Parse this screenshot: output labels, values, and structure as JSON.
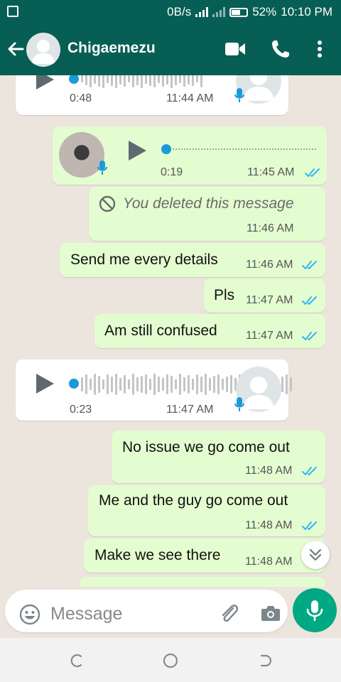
{
  "status_bar": {
    "net_speed": "0B/s",
    "battery": "52%",
    "time": "10:10 PM"
  },
  "header": {
    "contact_name": "Chigaemezu",
    "icons": [
      "back-arrow-icon",
      "avatar-icon",
      "video-call-icon",
      "phone-icon",
      "more-vert-icon"
    ]
  },
  "messages": [
    {
      "type": "voice",
      "direction": "in",
      "duration": "0:48",
      "time": "11:44 AM"
    },
    {
      "type": "voice",
      "direction": "out",
      "duration": "0:19",
      "time": "11:45 AM",
      "read": true
    },
    {
      "type": "deleted",
      "direction": "out",
      "text": "You deleted this message",
      "time": "11:46 AM"
    },
    {
      "type": "text",
      "direction": "out",
      "text": "Send me every details",
      "time": "11:46 AM",
      "read": true
    },
    {
      "type": "text",
      "direction": "out",
      "text": "Pls",
      "time": "11:47 AM",
      "read": true
    },
    {
      "type": "text",
      "direction": "out",
      "text": "Am still confused",
      "time": "11:47 AM",
      "read": true
    },
    {
      "type": "voice",
      "direction": "in",
      "duration": "0:23",
      "time": "11:47 AM"
    },
    {
      "type": "text",
      "direction": "out",
      "text": "No issue we go come out",
      "time": "11:48 AM",
      "read": true
    },
    {
      "type": "text",
      "direction": "out",
      "text": "Me and the guy go come out",
      "time": "11:48 AM",
      "read": true
    },
    {
      "type": "text",
      "direction": "out",
      "text": "Make we see there",
      "time": "11:48 AM",
      "read": true
    }
  ],
  "composer": {
    "placeholder": "Message"
  },
  "colors": {
    "header": "#075e54",
    "outgoing_bubble": "#e3fdd0",
    "incoming_bubble": "#ffffff",
    "chat_background": "#ece5dd",
    "read_ticks": "#34b7f1",
    "accent": "#00a884"
  }
}
